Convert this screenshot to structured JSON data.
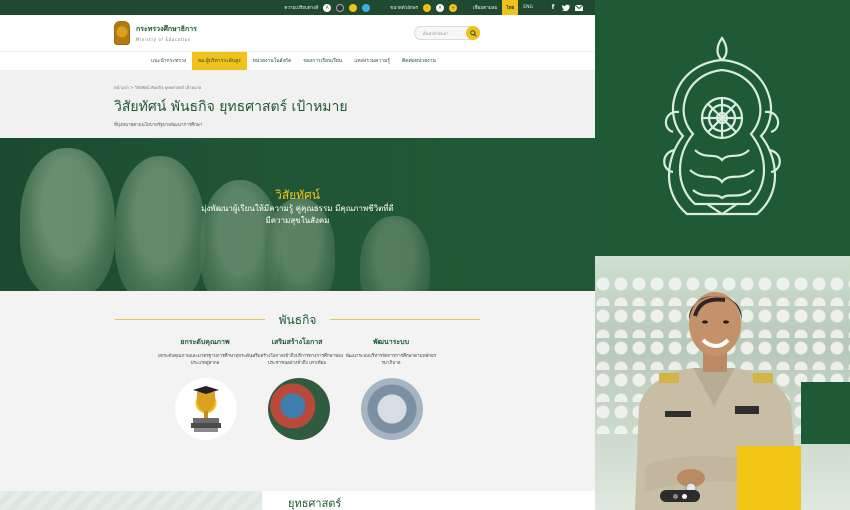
{
  "topbar": {
    "contrast_label": "ความเปรียบต่างสี",
    "font_size_label": "ขนาดตัวอักษร",
    "sitemap_label": "เชื่อมตามลม",
    "lang_th": "ไทย",
    "lang_en": "ENG",
    "contrast_a": "A",
    "font_a": "A"
  },
  "header": {
    "brand_th": "กระทรวงศึกษาธิการ",
    "brand_en": "Ministry of Education",
    "search_placeholder": "ค้นหาคำค้นหา"
  },
  "nav": {
    "items": [
      "แนะนำกระทรวง",
      "ผอ.ผู้บริหารระดับสูง",
      "หน่วยงานในสังกัด",
      "ของการเรียนเรียน",
      "แหล่งรวมความรู้",
      "ติดต่อหน่วยงาน"
    ]
  },
  "page": {
    "breadcrumb": "หน้าแรก   >   วิสัยทัศน์ พันธกิจ ยุทธศาสตร์ เป้าหมาย",
    "title": "วิสัยทัศน์ พันธกิจ ยุทธศาสตร์ เป้าหมาย",
    "subtitle": "ที่มุ่งหมายตามนโยบายรัฐบาลพัฒนาการศึกษา"
  },
  "hero": {
    "title": "วิสัยทัศน์",
    "line1": "มุ่งพัฒนาผู้เรียนให้มีความรู้ คู่คุณธรรม มีคุณภาพชีวิตที่ดี",
    "line2": "มีความสุขในสังคม"
  },
  "mission": {
    "title": "พันธกิจ",
    "columns": [
      {
        "heading": "ยกระดับคุณภาพ",
        "text": "ยกระดับคุณภาพและมาตรฐานการศึกษาทุกระดับประเภทสู่สากล"
      },
      {
        "heading": "เสริมสร้างโอกาส",
        "text": "เสริมสร้างโอกาสเข้าถึงบริการทางการศึกษาของประชาชนอย่างทั่วถึง เท่าเทียม"
      },
      {
        "heading": "พัฒนาระบบ",
        "text": "พัฒนาระบบบริหารจัดการการศึกษาตามหลักธรรมาภิบาล"
      }
    ]
  },
  "strategy": {
    "title": "ยุทธศาสตร์"
  },
  "colors": {
    "primary_green": "#1e5a35",
    "accent_yellow": "#f1c21b",
    "emblem_stroke": "#d8ece0"
  },
  "icons": [
    "contrast-icon",
    "font-size-icon",
    "facebook-icon",
    "twitter-icon",
    "mail-icon",
    "search-icon",
    "ministry-emblem-icon"
  ]
}
